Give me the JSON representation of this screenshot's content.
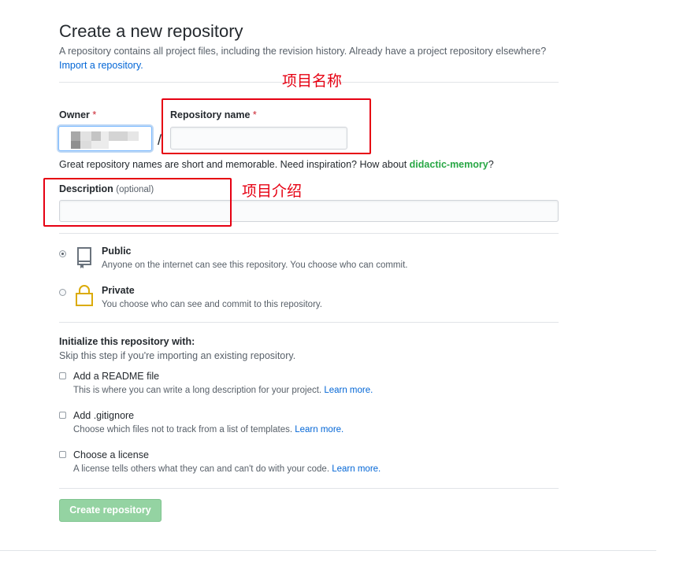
{
  "header": {
    "title": "Create a new repository",
    "subtitle": "A repository contains all project files, including the revision history. Already have a project repository elsewhere?",
    "import_link": "Import a repository."
  },
  "owner": {
    "label": "Owner",
    "required_mark": "*",
    "slash": "/"
  },
  "repo_name": {
    "label": "Repository name",
    "required_mark": "*",
    "value": ""
  },
  "name_hint": {
    "text": "Great repository names are short and memorable. Need inspiration? How about ",
    "suggestion": "didactic-memory",
    "suffix": "?"
  },
  "description": {
    "label": "Description",
    "optional": "(optional)",
    "value": ""
  },
  "visibility": {
    "selected": "public",
    "public": {
      "title": "Public",
      "desc": "Anyone on the internet can see this repository. You choose who can commit."
    },
    "private": {
      "title": "Private",
      "desc": "You choose who can see and commit to this repository."
    }
  },
  "init": {
    "heading": "Initialize this repository with:",
    "subheading": "Skip this step if you're importing an existing repository.",
    "readme": {
      "title": "Add a README file",
      "desc": "This is where you can write a long description for your project.",
      "link": "Learn more."
    },
    "gitignore": {
      "title": "Add .gitignore",
      "desc": "Choose which files not to track from a list of templates.",
      "link": "Learn more."
    },
    "license": {
      "title": "Choose a license",
      "desc": "A license tells others what they can and can't do with your code.",
      "link": "Learn more."
    }
  },
  "create_button": "Create repository",
  "annotations": {
    "project_name": "项目名称",
    "project_intro": "项目介绍"
  },
  "colors": {
    "accent_link": "#0366d6",
    "suggest_green": "#28a745",
    "button_green_disabled": "#94d3a2",
    "annotation_red": "#e60012",
    "private_lock": "#dbab09"
  }
}
